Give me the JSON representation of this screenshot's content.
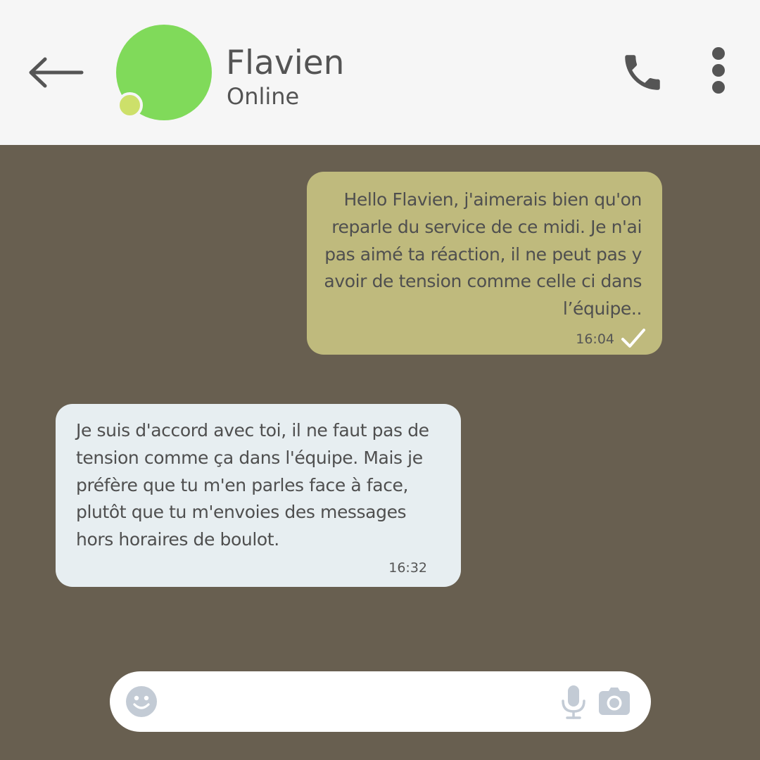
{
  "header": {
    "contact_name": "Flavien",
    "contact_status": "Online",
    "icons": {
      "back": "arrow-left-icon",
      "call": "phone-icon",
      "menu": "more-vertical-icon"
    }
  },
  "messages": [
    {
      "direction": "outgoing",
      "text": "Hello Flavien, j'aimerais bien qu'on reparle du service de ce midi. Je n'ai pas aimé ta réaction, il ne peut pas y avoir de tension  comme celle ci dans l’équipe..",
      "time": "16:04",
      "status_icon": "check-icon"
    },
    {
      "direction": "incoming",
      "text": "Je suis d'accord avec toi, il ne faut pas de tension comme ça dans l'équipe. Mais je préfère que tu m'en parles face à face, plutôt que tu m'envoies des messages hors horaires de boulot.",
      "time": "16:32"
    }
  ],
  "composer": {
    "value": "",
    "icons": {
      "emoji": "smiley-icon",
      "mic": "microphone-icon",
      "camera": "camera-icon"
    }
  },
  "colors": {
    "header_background": "#F6F6F6",
    "chat_background": "#685F50",
    "avatar": "#80DA5A",
    "online_dot": "#CDE06A",
    "outgoing_bubble": "#BFBA7D",
    "incoming_bubble": "#E7EEF1",
    "text": "#4F4F4F",
    "composer_icons": "#C3CBD5"
  }
}
